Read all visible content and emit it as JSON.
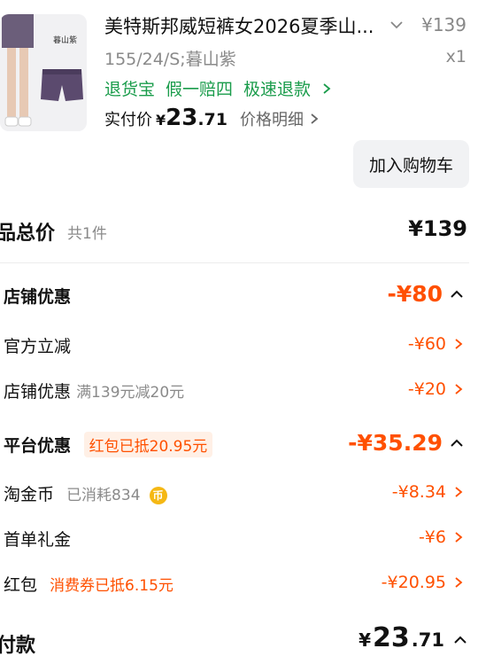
{
  "product": {
    "title": "美特斯邦威短裤女2026夏季山...",
    "price": "¥139",
    "spec": "155/24/S;暮山紫",
    "qty": "x1",
    "services": [
      "退货宝",
      "假一赔四",
      "极速退款"
    ],
    "paid_label": "实付价",
    "paid_yen": "¥",
    "paid_int": "23",
    "paid_dec": ".71",
    "detail_link": "价格明细",
    "thumb_tag": "暮山紫",
    "add_cart": "加入购物车"
  },
  "summary": {
    "label": "品总价",
    "count": "共1件",
    "value": "¥139"
  },
  "rows": {
    "store_discount": {
      "label": "店铺优惠",
      "value": "-¥80"
    },
    "official_cut": {
      "label": "官方立减",
      "value": "-¥60"
    },
    "store_coupon": {
      "label": "店铺优惠",
      "sub": "满139元减20元",
      "value": "-¥20"
    },
    "platform": {
      "label": "平台优惠",
      "tag": "红包已抵20.95元",
      "value": "-¥35.29"
    },
    "taojinbi": {
      "label": "淘金币",
      "sub": "已消耗834",
      "coin": "币",
      "value": "-¥8.34"
    },
    "first_gift": {
      "label": "首单礼金",
      "value": "-¥6"
    },
    "hongbao": {
      "label": "红包",
      "tag": "消费券已抵6.15元",
      "value": "-¥20.95"
    }
  },
  "payment": {
    "label": "付款",
    "yen": "¥",
    "int": "23",
    "dec": ".71"
  },
  "colors": {
    "accent": "#ff5000",
    "service_green": "#1a9c4b",
    "muted": "#8a8a8a"
  }
}
